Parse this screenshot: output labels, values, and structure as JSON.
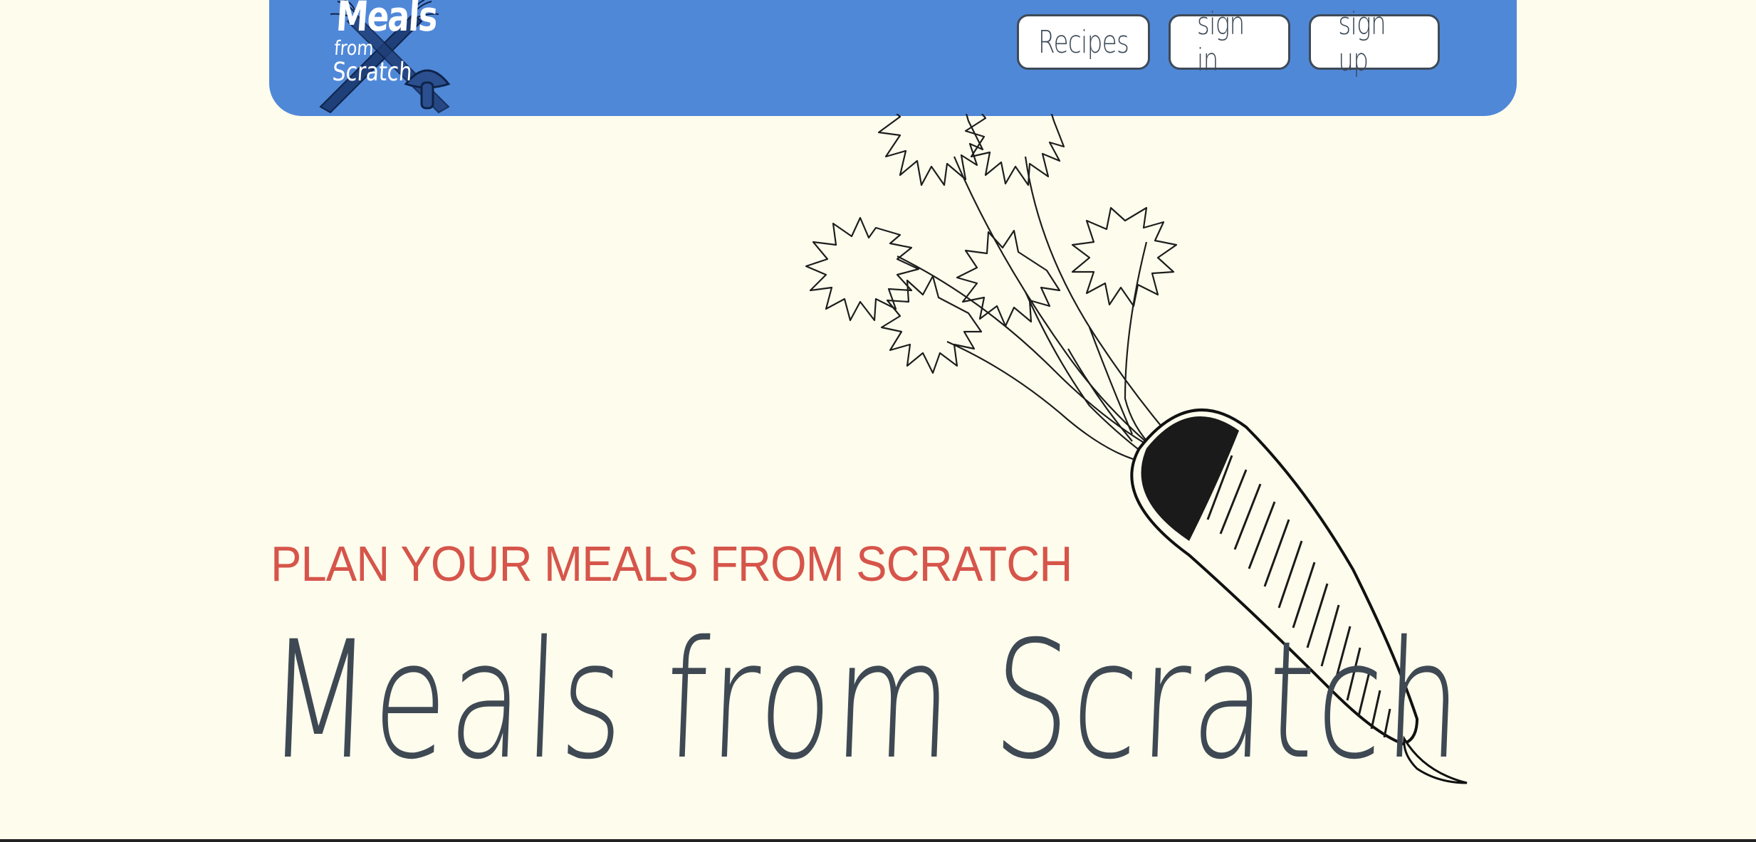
{
  "brand": {
    "logo_line_1": "Meals",
    "logo_line_2": "from",
    "logo_line_3": "Scratch",
    "logo_icon": "carrot-mushroom-illustration",
    "nav_bg_color": "#5088d8"
  },
  "nav": {
    "items": [
      {
        "label": "Recipes",
        "icon": null
      },
      {
        "label": "sign in",
        "icon": null
      },
      {
        "label": "sign up",
        "icon": null
      }
    ]
  },
  "hero": {
    "subtitle": "PLAN YOUR MEALS FROM SCRATCH",
    "title": "Meals from Scratch",
    "illustration": "carrot-icon",
    "subtitle_color": "#d6554b",
    "title_color": "#3f4953",
    "background_color": "#fefded"
  }
}
